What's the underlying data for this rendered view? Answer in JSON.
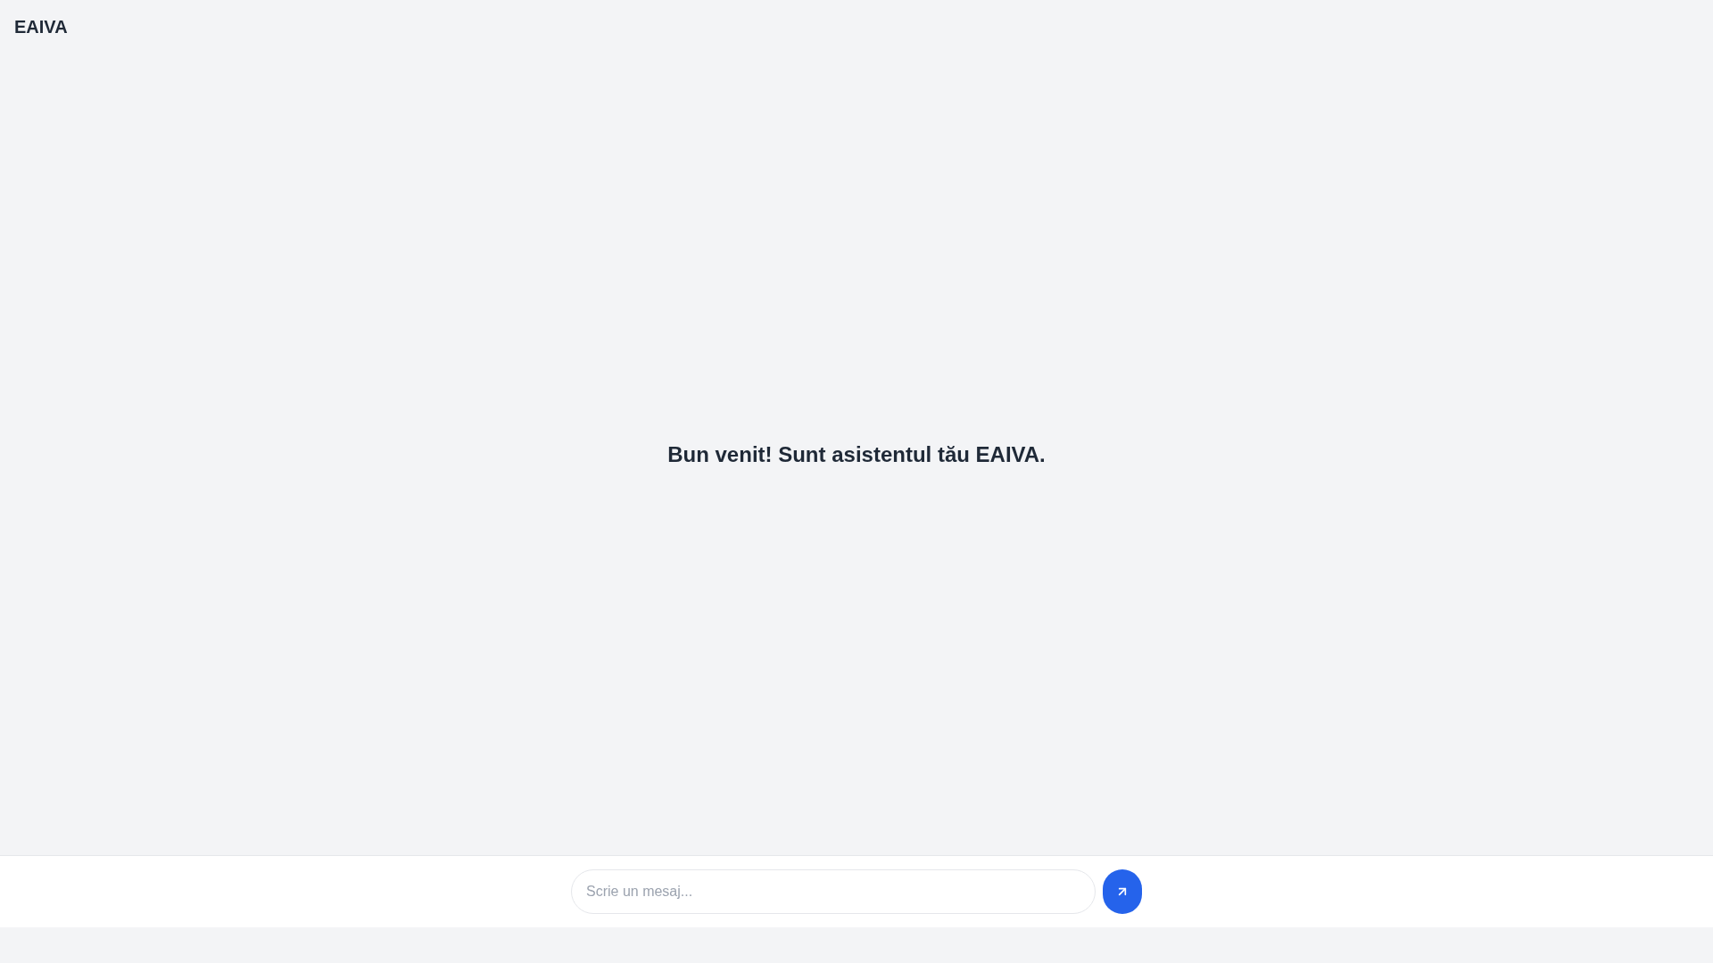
{
  "header": {
    "logo": "EAIVA"
  },
  "welcome": {
    "message": "Bun venit! Sunt asistentul tău EAIVA."
  },
  "composer": {
    "placeholder": "Scrie un mesaj..."
  }
}
